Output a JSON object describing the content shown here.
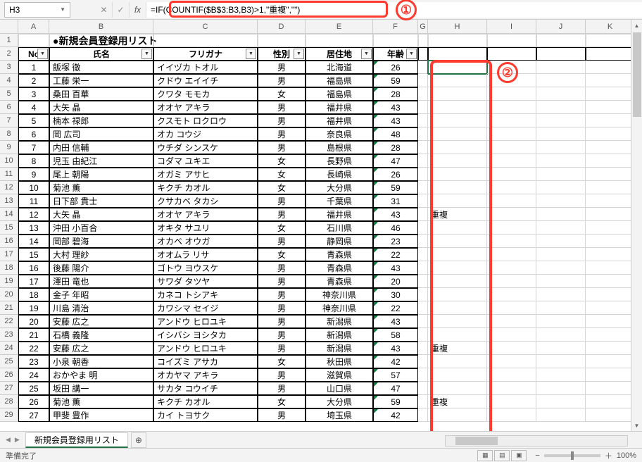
{
  "name_box": "H3",
  "formula": "=IF(COUNTIF($B$3:B3,B3)>1,\"重複\",\"\")",
  "callouts": {
    "one": "①",
    "two": "②"
  },
  "columns": [
    "A",
    "B",
    "C",
    "D",
    "E",
    "F",
    "G",
    "H",
    "I",
    "J",
    "K"
  ],
  "title": "●新規会員登録用リスト",
  "headers": {
    "no": "No",
    "name": "氏名",
    "kana": "フリガナ",
    "sex": "性別",
    "pref": "居住地",
    "age": "年齢"
  },
  "rows_start": 1,
  "data": [
    {
      "no": 1,
      "name": "飯塚 徹",
      "kana": "イイヅカ トオル",
      "sex": "男",
      "pref": "北海道",
      "age": 26,
      "h": ""
    },
    {
      "no": 2,
      "name": "工藤 栄一",
      "kana": "クドウ エイイチ",
      "sex": "男",
      "pref": "福島県",
      "age": 59,
      "h": ""
    },
    {
      "no": 3,
      "name": "桑田 百華",
      "kana": "クワタ モモカ",
      "sex": "女",
      "pref": "福島県",
      "age": 28,
      "h": ""
    },
    {
      "no": 4,
      "name": "大矢 晶",
      "kana": "オオヤ アキラ",
      "sex": "男",
      "pref": "福井県",
      "age": 43,
      "h": ""
    },
    {
      "no": 5,
      "name": "楠本 禄郎",
      "kana": "クスモト ロクロウ",
      "sex": "男",
      "pref": "福井県",
      "age": 43,
      "h": ""
    },
    {
      "no": 6,
      "name": "岡 広司",
      "kana": "オカ コウジ",
      "sex": "男",
      "pref": "奈良県",
      "age": 48,
      "h": ""
    },
    {
      "no": 7,
      "name": "内田 信輔",
      "kana": "ウチダ シンスケ",
      "sex": "男",
      "pref": "島根県",
      "age": 28,
      "h": ""
    },
    {
      "no": 8,
      "name": "児玉 由紀江",
      "kana": "コダマ ユキエ",
      "sex": "女",
      "pref": "長野県",
      "age": 47,
      "h": ""
    },
    {
      "no": 9,
      "name": "尾上 朝陽",
      "kana": "オガミ アサヒ",
      "sex": "女",
      "pref": "長崎県",
      "age": 26,
      "h": ""
    },
    {
      "no": 10,
      "name": "菊池 薫",
      "kana": "キクチ カオル",
      "sex": "女",
      "pref": "大分県",
      "age": 59,
      "h": ""
    },
    {
      "no": 11,
      "name": "日下部 貴士",
      "kana": "クサカベ タカシ",
      "sex": "男",
      "pref": "千葉県",
      "age": 31,
      "h": ""
    },
    {
      "no": 12,
      "name": "大矢 晶",
      "kana": "オオヤ アキラ",
      "sex": "男",
      "pref": "福井県",
      "age": 43,
      "h": "重複"
    },
    {
      "no": 13,
      "name": "沖田 小百合",
      "kana": "オキタ サユリ",
      "sex": "女",
      "pref": "石川県",
      "age": 46,
      "h": ""
    },
    {
      "no": 14,
      "name": "岡部 碧海",
      "kana": "オカベ オウガ",
      "sex": "男",
      "pref": "静岡県",
      "age": 23,
      "h": ""
    },
    {
      "no": 15,
      "name": "大村 理紗",
      "kana": "オオムラ リサ",
      "sex": "女",
      "pref": "青森県",
      "age": 22,
      "h": ""
    },
    {
      "no": 16,
      "name": "後藤 陽介",
      "kana": "ゴトウ ヨウスケ",
      "sex": "男",
      "pref": "青森県",
      "age": 43,
      "h": ""
    },
    {
      "no": 17,
      "name": "澤田 竜也",
      "kana": "サワダ タツヤ",
      "sex": "男",
      "pref": "青森県",
      "age": 20,
      "h": ""
    },
    {
      "no": 18,
      "name": "金子 年昭",
      "kana": "カネコ トシアキ",
      "sex": "男",
      "pref": "神奈川県",
      "age": 30,
      "h": ""
    },
    {
      "no": 19,
      "name": "川島 清治",
      "kana": "カワシマ セイジ",
      "sex": "男",
      "pref": "神奈川県",
      "age": 22,
      "h": ""
    },
    {
      "no": 20,
      "name": "安藤 広之",
      "kana": "アンドウ ヒロユキ",
      "sex": "男",
      "pref": "新潟県",
      "age": 43,
      "h": ""
    },
    {
      "no": 21,
      "name": "石橋 義隆",
      "kana": "イシバシ ヨシタカ",
      "sex": "男",
      "pref": "新潟県",
      "age": 58,
      "h": ""
    },
    {
      "no": 22,
      "name": "安藤 広之",
      "kana": "アンドウ ヒロユキ",
      "sex": "男",
      "pref": "新潟県",
      "age": 43,
      "h": "重複"
    },
    {
      "no": 23,
      "name": "小泉 朝香",
      "kana": "コイズミ アサカ",
      "sex": "女",
      "pref": "秋田県",
      "age": 42,
      "h": ""
    },
    {
      "no": 24,
      "name": "おかやま 明",
      "kana": "オカヤマ アキラ",
      "sex": "男",
      "pref": "滋賀県",
      "age": 57,
      "h": ""
    },
    {
      "no": 25,
      "name": "坂田 講一",
      "kana": "サカタ コウイチ",
      "sex": "男",
      "pref": "山口県",
      "age": 47,
      "h": ""
    },
    {
      "no": 26,
      "name": "菊池 薫",
      "kana": "キクチ カオル",
      "sex": "女",
      "pref": "大分県",
      "age": 59,
      "h": "重複"
    },
    {
      "no": 27,
      "name": "甲斐 豊作",
      "kana": "カイ トヨサク",
      "sex": "男",
      "pref": "埼玉県",
      "age": 42,
      "h": ""
    }
  ],
  "sheet_tab": "新規会員登録用リスト",
  "status": "準備完了",
  "zoom": "100%"
}
